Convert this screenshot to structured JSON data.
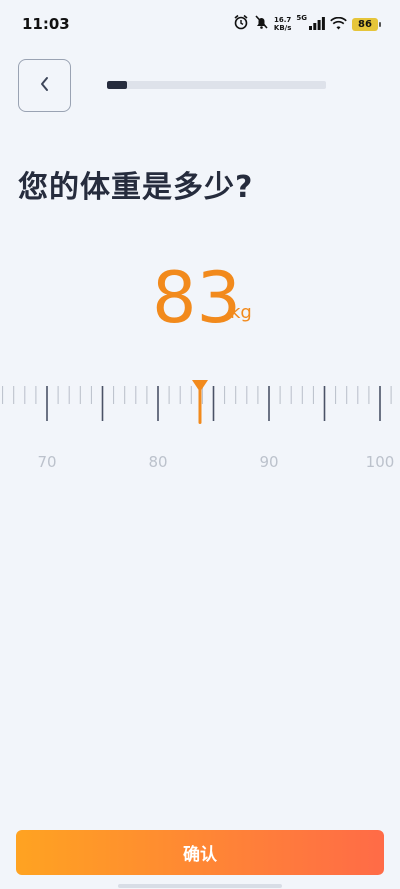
{
  "status_bar": {
    "time": "11:03",
    "net_speed_value": "16.7",
    "net_speed_unit": "KB/s",
    "signal_label": "5G",
    "battery": "86"
  },
  "progress": {
    "fraction": 0.09
  },
  "title": "您的体重是多少?",
  "weight": {
    "value": "83",
    "unit": "kg"
  },
  "ruler": {
    "min_visible": 66,
    "max_visible": 100,
    "selected": 83,
    "labels": [
      "70",
      "80",
      "90",
      "100"
    ]
  },
  "confirm_label": "确认",
  "colors": {
    "accent": "#f28a1c",
    "dark": "#262c3d",
    "background": "#f2f5fa",
    "button_start": "#ffa321",
    "button_end": "#ff6b47"
  }
}
